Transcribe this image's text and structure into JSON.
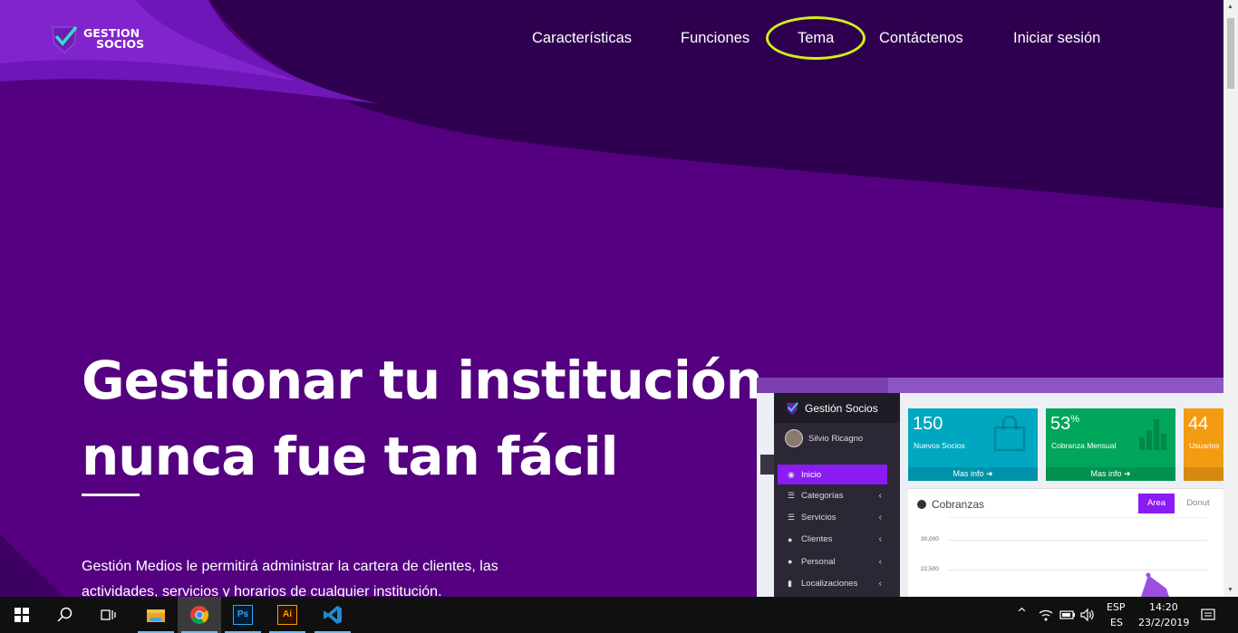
{
  "logo": {
    "line1": "GESTION",
    "line2": "SOCIOS"
  },
  "nav": {
    "items": [
      {
        "label": "Características"
      },
      {
        "label": "Funciones"
      },
      {
        "label": "Tema"
      },
      {
        "label": "Contáctenos"
      },
      {
        "label": "Iniciar sesión"
      }
    ]
  },
  "hero": {
    "title_line1": "Gestionar tu institución",
    "title_line2": "nunca fue tan fácil",
    "description_line1": "Gestión Medios le permitirá administrar la cartera de clientes, las",
    "description_line2": "actividades, servicios y horarios de cualquier institución."
  },
  "mockup": {
    "brand": "Gestión Socios",
    "user": "Silvio Ricagno",
    "menu": [
      {
        "label": "Inicio",
        "icon": "dashboard-icon"
      },
      {
        "label": "Categorías",
        "icon": "list-icon"
      },
      {
        "label": "Servicios",
        "icon": "list-icon"
      },
      {
        "label": "Clientes",
        "icon": "users-icon"
      },
      {
        "label": "Personal",
        "icon": "user-icon"
      },
      {
        "label": "Localizaciones",
        "icon": "building-icon"
      }
    ],
    "cards": [
      {
        "value": "150",
        "label": "Nuevos Socios",
        "footer": "Mas info",
        "color": "#00a7c0"
      },
      {
        "value": "53",
        "suffix": "%",
        "label": "Cobranza Mensual",
        "footer": "Mas info",
        "color": "#00a65a"
      },
      {
        "value": "44",
        "label": "Usuarios",
        "color": "#f39c12"
      }
    ],
    "chart_panel": {
      "title": "Cobranzas",
      "tab_active": "Area",
      "tab_inactive": "Donut",
      "y_ticks": [
        "30,000",
        "22,500"
      ]
    }
  },
  "taskbar": {
    "apps": [
      "start-icon",
      "search-icon",
      "task-view-icon",
      "file-explorer-icon",
      "chrome-icon",
      "photoshop-icon",
      "illustrator-icon",
      "vscode-icon"
    ],
    "lang_top": "ESP",
    "lang_bottom": "ES",
    "time": "14:20",
    "date": "23/2/2019"
  },
  "colors": {
    "bg": "#540080",
    "dark": "#2f0050",
    "accent": "#8a1bf2",
    "highlight": "#d4ee17"
  }
}
